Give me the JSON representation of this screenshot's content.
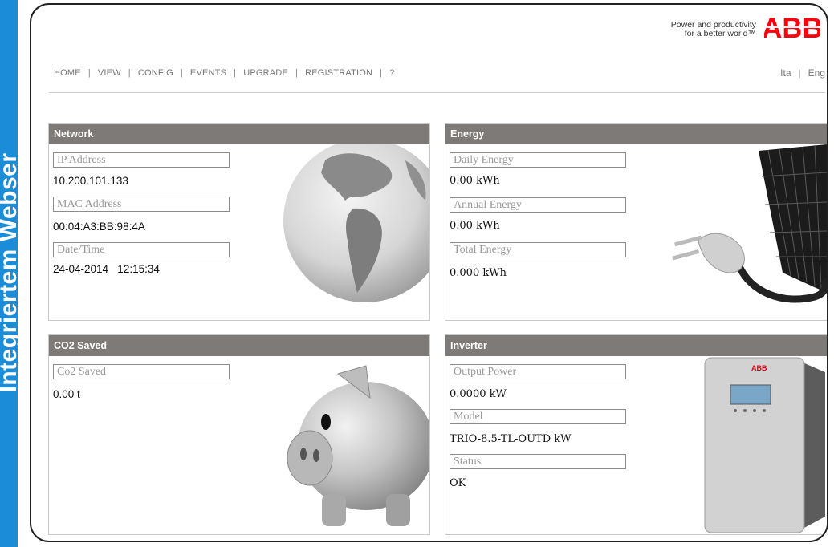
{
  "side_label": "Integriertem Webser",
  "brand": {
    "tagline_line1": "Power and productivity",
    "tagline_line2": "for a better world™",
    "logo_text": "ABB"
  },
  "nav": [
    "HOME",
    "VIEW",
    "CONFIG",
    "EVENTS",
    "UPGRADE",
    "REGISTRATION",
    "?"
  ],
  "lang": [
    "Ita",
    "Eng"
  ],
  "network": {
    "title": "Network",
    "ip_label": "IP Address",
    "ip_value": "10.200.101.133",
    "mac_label": "MAC Address",
    "mac_value": "00:04:A3:BB:98:4A",
    "datetime_label": "Date/Time",
    "datetime_value": "24-04-2014   12:15:34"
  },
  "energy": {
    "title": "Energy",
    "daily_label": "Daily Energy",
    "daily_value": "0.00 kWh",
    "annual_label": "Annual Energy",
    "annual_value": "0.00 kWh",
    "total_label": "Total Energy",
    "total_value": "0.000 kWh"
  },
  "co2": {
    "title": "CO2 Saved",
    "label": "Co2 Saved",
    "value": "0.00 t"
  },
  "inverter": {
    "title": "Inverter",
    "power_label": "Output Power",
    "power_value": "0.0000 kW",
    "model_label": "Model",
    "model_value": "TRIO-8.5-TL-OUTD kW",
    "status_label": "Status",
    "status_value": "OK",
    "device_brand": "ABB"
  },
  "colors": {
    "accent": "#1a8cd8",
    "header_bar": "#7d7a78",
    "abb_red": "#ff000f"
  }
}
